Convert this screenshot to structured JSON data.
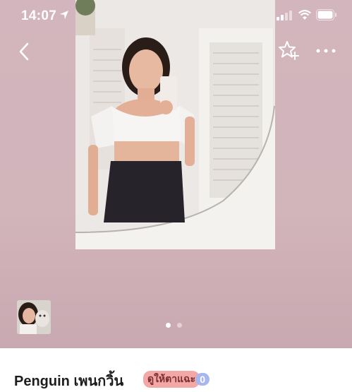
{
  "status_bar": {
    "time": "14:07"
  },
  "profile": {
    "name": "Penguin เพนกวิ้น",
    "badge_1": "ดูให้ตาแฉะ",
    "badge_2": "0"
  },
  "carousel": {
    "total": 2,
    "active_index": 0
  },
  "colors": {
    "background": "#d3b6bd",
    "footer": "#ffffff"
  },
  "icons": [
    "location-arrow-icon",
    "signal-icon",
    "wifi-icon",
    "battery-icon",
    "back-chevron-icon",
    "add-favorite-star-icon",
    "more-options-icon"
  ]
}
